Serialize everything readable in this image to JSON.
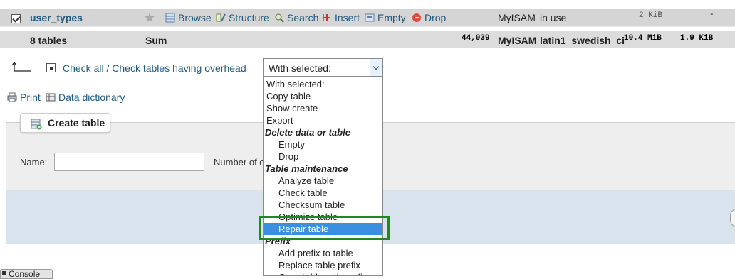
{
  "row_user_types": {
    "name": "user_types",
    "actions": [
      "Browse",
      "Structure",
      "Search",
      "Insert",
      "Empty",
      "Drop"
    ],
    "engine": "MyISAM",
    "status": "in use",
    "size": "2 KiB",
    "overhead": "-"
  },
  "row_sum": {
    "tables": "8 tables",
    "sum": "Sum",
    "rows": "44,039",
    "engine": "MyISAM",
    "collation": "latin1_swedish_ci",
    "size": "10.4 MiB",
    "overhead": "1.9 KiB"
  },
  "bulk": {
    "check_all": "Check all",
    "separator": " / ",
    "check_overhead": "Check tables having overhead",
    "select_value": "With selected:"
  },
  "dropdown": {
    "options": [
      {
        "label": "With selected:",
        "kind": "option",
        "level": 1
      },
      {
        "label": "Copy table",
        "kind": "option",
        "level": 1
      },
      {
        "label": "Show create",
        "kind": "option",
        "level": 1
      },
      {
        "label": "Export",
        "kind": "option",
        "level": 1
      },
      {
        "label": "Delete data or table",
        "kind": "group"
      },
      {
        "label": "Empty",
        "kind": "option",
        "level": 2
      },
      {
        "label": "Drop",
        "kind": "option",
        "level": 2
      },
      {
        "label": "Table maintenance",
        "kind": "group"
      },
      {
        "label": "Analyze table",
        "kind": "option",
        "level": 2
      },
      {
        "label": "Check table",
        "kind": "option",
        "level": 2
      },
      {
        "label": "Checksum table",
        "kind": "option",
        "level": 2
      },
      {
        "label": "Optimize table",
        "kind": "option",
        "level": 2
      },
      {
        "label": "Repair table",
        "kind": "option",
        "level": 2,
        "selected": true
      },
      {
        "label": "Prefix",
        "kind": "group"
      },
      {
        "label": "Add prefix to table",
        "kind": "option",
        "level": 2
      },
      {
        "label": "Replace table prefix",
        "kind": "option",
        "level": 2
      },
      {
        "label": "Copy table with prefix",
        "kind": "option",
        "level": 2
      }
    ]
  },
  "links": {
    "print": "Print",
    "data_dictionary": "Data dictionary"
  },
  "create_table": {
    "tab_label": "Create table",
    "name_label": "Name:",
    "columns_label": "Number of columns:"
  },
  "console": {
    "label": "Console"
  },
  "colors": {
    "selected_option": "#3b8fe0",
    "highlight_border": "#1e8a1e",
    "link": "#235a81"
  }
}
